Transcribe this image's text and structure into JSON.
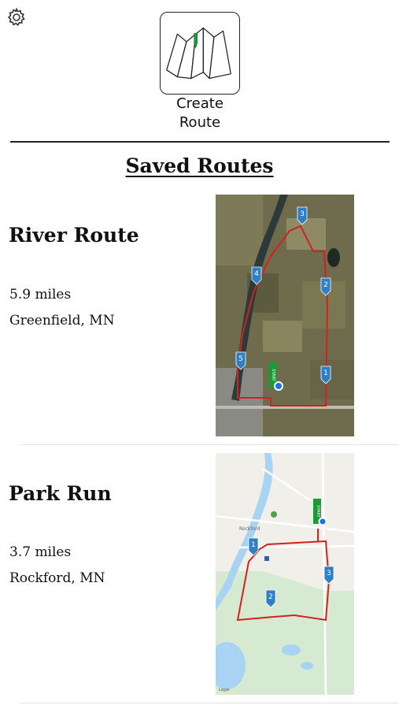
{
  "header": {
    "settings_icon": "gear-icon",
    "create_icon": "folded-map-icon",
    "create_line1": "Create",
    "create_line2": "Route"
  },
  "section_title": "Saved Routes",
  "routes": [
    {
      "name": "River Route",
      "distance": "5.9 miles",
      "location": "Greenfield, MN",
      "map_style": "satellite",
      "markers": [
        "1",
        "2",
        "3",
        "4",
        "5"
      ],
      "start_label": "START"
    },
    {
      "name": "Park Run",
      "distance": "3.7 miles",
      "location": "Rockford, MN",
      "map_style": "standard",
      "markers": [
        "1",
        "2",
        "3"
      ],
      "start_label": "START",
      "map_labels": [
        "Rockford",
        "Legal"
      ]
    }
  ],
  "colors": {
    "route_line": "#d62020",
    "marker": "#2f7fc6",
    "start_flag": "#1a9a35",
    "current_location": "#1e6ff0"
  }
}
